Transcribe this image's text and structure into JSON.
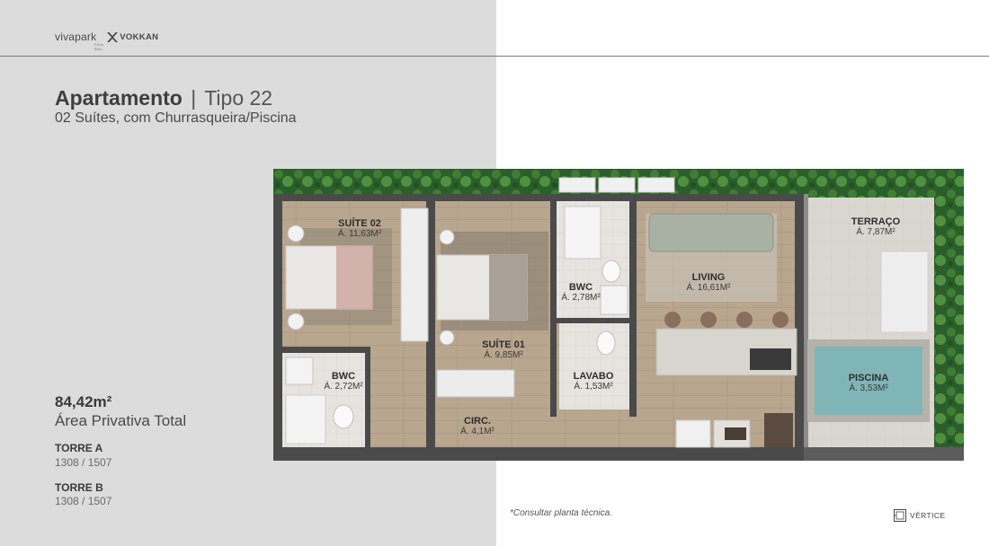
{
  "brand": {
    "vivapark": "vivapark",
    "vivapark_sub": "Porto Belo",
    "vokkan": "VOKKAN",
    "vertice": "VÉRTICE"
  },
  "header": {
    "title_bold": "Apartamento",
    "separator": "|",
    "title_type": "Tipo 22",
    "subtitle": "02 Suítes, com Churrasqueira/Piscina"
  },
  "summary": {
    "area_value": "84,42m²",
    "area_label": "Área Privativa Total",
    "towers": [
      {
        "name": "TORRE A",
        "units": "1308 / 1507"
      },
      {
        "name": "TORRE B",
        "units": "1308 / 1507"
      }
    ]
  },
  "rooms": [
    {
      "id": "suite02",
      "name": "SUÍTE 02",
      "area": "Á. 11,63M²"
    },
    {
      "id": "suite01",
      "name": "SUÍTE 01",
      "area": "Á. 9,85M²"
    },
    {
      "id": "bwc1",
      "name": "BWC",
      "area": "Á. 2,78M²"
    },
    {
      "id": "bwc2",
      "name": "BWC",
      "area": "Á. 2,72M²"
    },
    {
      "id": "living",
      "name": "LIVING",
      "area": "Á. 16,61M²"
    },
    {
      "id": "terraco",
      "name": "TERRAÇO",
      "area": "Á. 7,87M²"
    },
    {
      "id": "lavabo",
      "name": "LAVABO",
      "area": "Á. 1,53M²"
    },
    {
      "id": "piscina",
      "name": "PISCINA",
      "area": "Á. 3,53M²"
    },
    {
      "id": "circ",
      "name": "CIRC.",
      "area": "Á. 4,1M²"
    }
  ],
  "footer": {
    "note": "*Consultar planta técnica."
  },
  "colors": {
    "left_panel": "#dcdcdc",
    "wall": "#4a4a4a",
    "wood_floor": "#b8a48c",
    "tile_floor": "#e4e2dc",
    "terrace_floor": "#d8d5cf",
    "pool_water": "#7fb5b6",
    "foliage": "#2f6b2e"
  }
}
